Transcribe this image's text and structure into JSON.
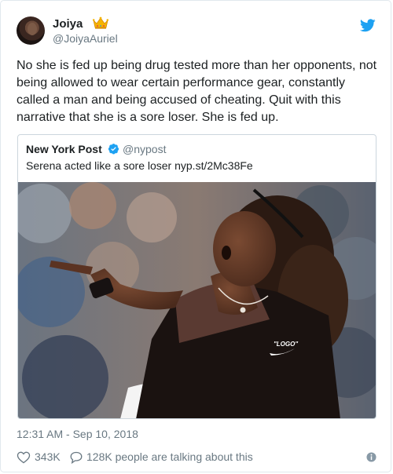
{
  "tweet": {
    "display_name": "Joiya",
    "handle": "@JoiyaAuriel",
    "text": "No she is fed up being drug tested more than her opponents, not being allowed to wear certain performance gear, constantly called a man and being accused of cheating. Quit with this narrative that she is a sore loser. She is fed up.",
    "timestamp": "12:31 AM - Sep 10, 2018",
    "likes": "343K",
    "conversation": "128K people are talking about this"
  },
  "quote": {
    "display_name": "New York Post",
    "handle": "@nypost",
    "text": "Serena acted like a sore loser nyp.st/2Mc38Fe",
    "shirt_logo_text": "\"LOGO\""
  },
  "icons": {
    "crown": "crown-icon",
    "bird": "twitter-bird-icon",
    "verified": "verified-badge-icon",
    "like": "heart-icon",
    "reply": "speech-bubble-icon",
    "info": "info-icon"
  },
  "colors": {
    "twitter_blue": "#1da1f2",
    "text": "#1c2022",
    "secondary": "#697882",
    "border": "#e1e8ed"
  }
}
